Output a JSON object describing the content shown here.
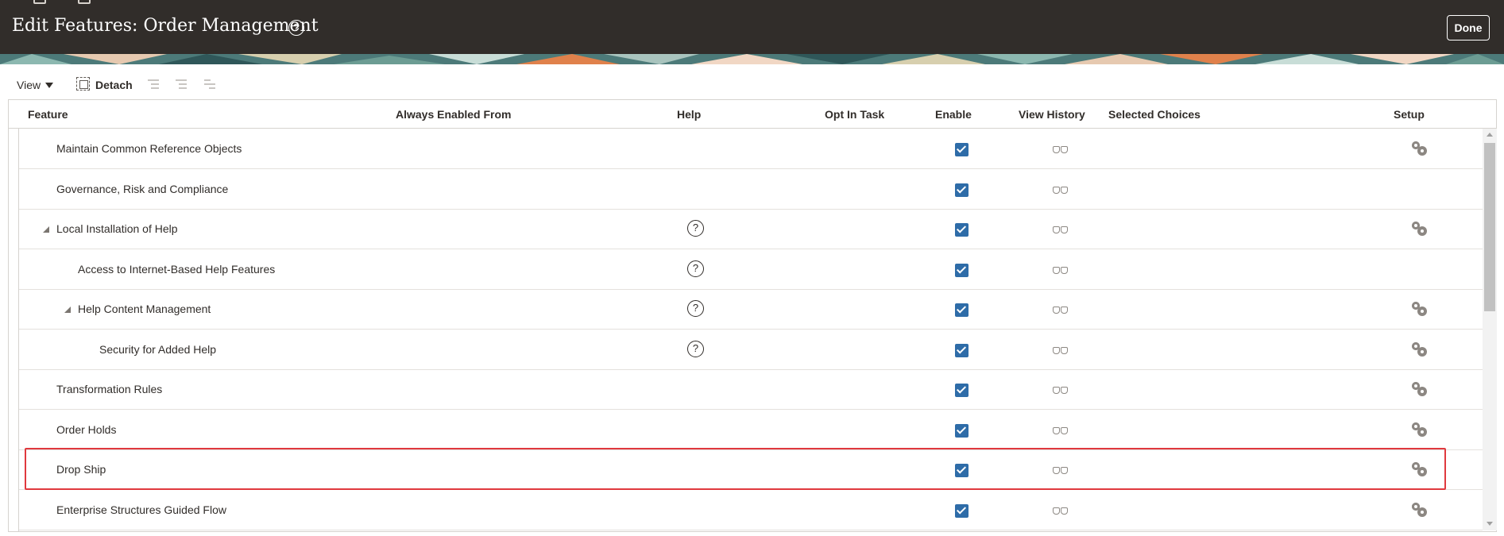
{
  "header": {
    "title": "Edit Features: Order Management",
    "help_glyph": "?",
    "done_label": "Done"
  },
  "toolbar": {
    "view_label": "View",
    "detach_label": "Detach"
  },
  "table": {
    "columns": [
      "Feature",
      "Always Enabled From",
      "Help",
      "Opt In Task",
      "Enable",
      "View History",
      "Selected Choices",
      "Setup"
    ],
    "rows": [
      {
        "feature": "Maintain Common Reference Objects",
        "level": 0,
        "expandable": false,
        "help": false,
        "enabled": true,
        "setup": true
      },
      {
        "feature": "Governance, Risk and Compliance",
        "level": 0,
        "expandable": false,
        "help": false,
        "enabled": true,
        "setup": false
      },
      {
        "feature": "Local Installation of Help",
        "level": 0,
        "expandable": true,
        "help": true,
        "enabled": true,
        "setup": true
      },
      {
        "feature": "Access to Internet-Based Help Features",
        "level": 1,
        "expandable": false,
        "help": true,
        "enabled": true,
        "setup": false
      },
      {
        "feature": "Help Content Management",
        "level": 1,
        "expandable": true,
        "help": true,
        "enabled": true,
        "setup": true
      },
      {
        "feature": "Security for Added Help",
        "level": 2,
        "expandable": false,
        "help": true,
        "enabled": true,
        "setup": true
      },
      {
        "feature": "Transformation Rules",
        "level": 0,
        "expandable": false,
        "help": false,
        "enabled": true,
        "setup": true
      },
      {
        "feature": "Order Holds",
        "level": 0,
        "expandable": false,
        "help": false,
        "enabled": true,
        "setup": true
      },
      {
        "feature": "Drop Ship",
        "level": 0,
        "expandable": false,
        "help": false,
        "enabled": true,
        "setup": true
      },
      {
        "feature": "Enterprise Structures Guided Flow",
        "level": 0,
        "expandable": false,
        "help": false,
        "enabled": true,
        "setup": true
      }
    ]
  },
  "colors": {
    "header_bg": "#312d2a",
    "checkbox": "#2e6ca8",
    "highlight": "#e0393e"
  }
}
